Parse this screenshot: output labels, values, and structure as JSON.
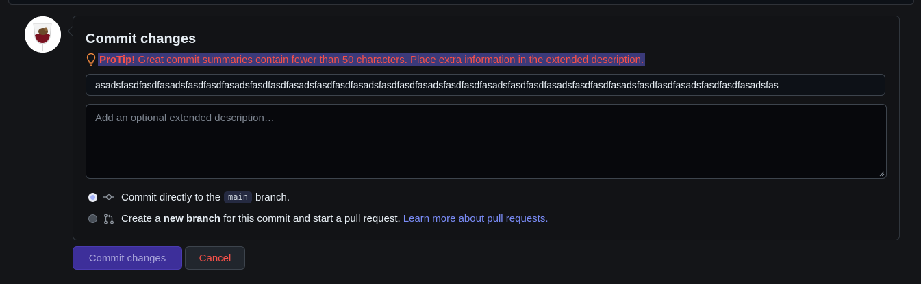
{
  "heading": "Commit changes",
  "protip": {
    "label": "ProTip!",
    "message": " Great commit summaries contain fewer than 50 characters. Place extra information in the extended description."
  },
  "summary": {
    "value": "asadsfasdfasdfasadsfasdfasdfasadsfasdfasdfasadsfasdfasdfasadsfasdfasdfasadsfasdfasdfasadsfasdfasdfasadsfasdfasdfasadsfasdfasdfasadsfasdfasdfasadsfas"
  },
  "description": {
    "placeholder": "Add an optional extended description…"
  },
  "options": {
    "direct": {
      "prefix": "Commit directly to the",
      "branch": "main",
      "suffix": "branch.",
      "selected": true
    },
    "new_branch": {
      "prefix": "Create a",
      "bold": "new branch",
      "suffix": "for this commit and start a pull request.",
      "link": "Learn more about pull requests.",
      "selected": false
    }
  },
  "buttons": {
    "commit": "Commit changes",
    "cancel": "Cancel"
  },
  "colors": {
    "protip_highlight": "#3b3a7a",
    "protip_text": "#f85149",
    "link": "#7a8cf7",
    "primary_button": "#3d2f9a"
  },
  "icons": {
    "protip": "light-bulb-icon",
    "commit": "git-commit-icon",
    "pull_request": "git-pull-request-icon"
  }
}
